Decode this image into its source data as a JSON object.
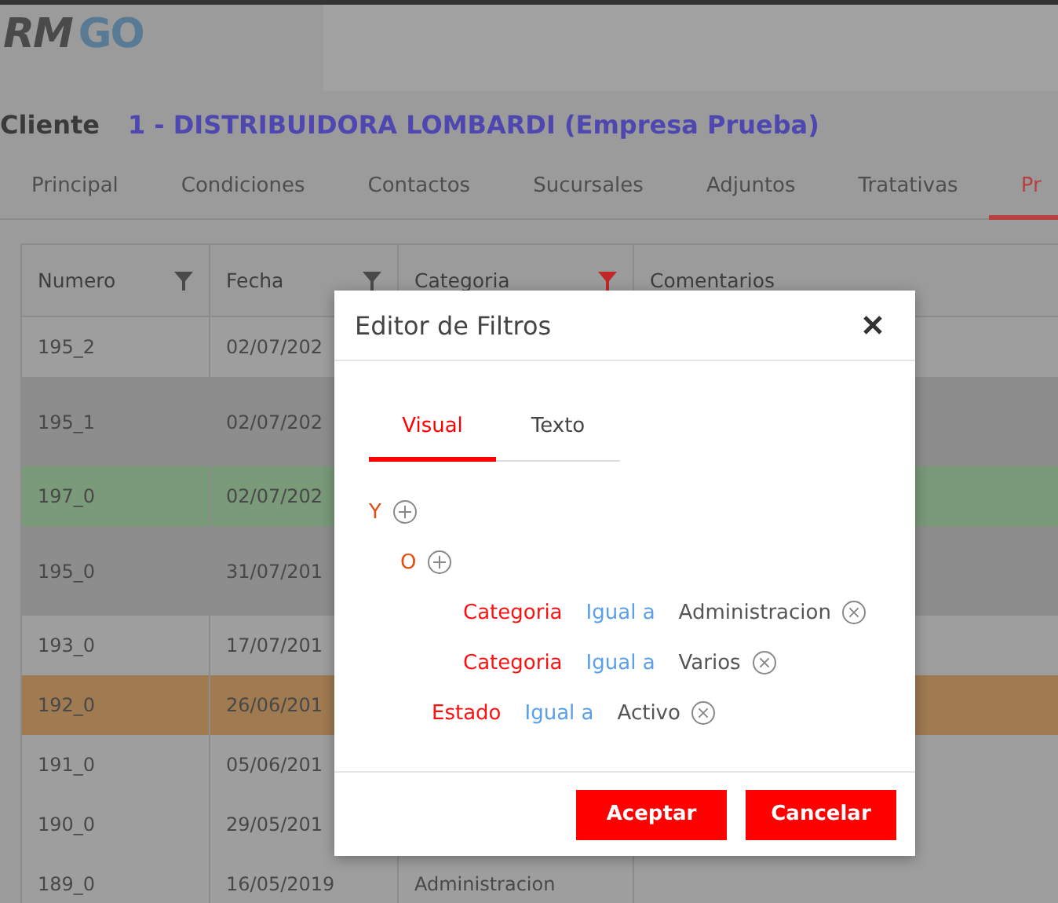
{
  "logo": {
    "part_1": "RM",
    "part_2": "GO"
  },
  "client": {
    "label": "Cliente",
    "name": "1 - DISTRIBUIDORA LOMBARDI (Empresa Prueba)"
  },
  "tabs": [
    {
      "label": "Principal",
      "selected": false
    },
    {
      "label": "Condiciones",
      "selected": false
    },
    {
      "label": "Contactos",
      "selected": false
    },
    {
      "label": "Sucursales",
      "selected": false
    },
    {
      "label": "Adjuntos",
      "selected": false
    },
    {
      "label": "Tratativas",
      "selected": false
    },
    {
      "label": "Pr",
      "selected": true
    }
  ],
  "table": {
    "columns": [
      {
        "label": "Numero",
        "kind": "filterable",
        "filter_active": false
      },
      {
        "label": "Fecha",
        "kind": "filterable",
        "filter_active": false
      },
      {
        "label": "Categoria",
        "kind": "filterable",
        "filter_active": true
      },
      {
        "label": "Comentarios",
        "kind": "plain"
      }
    ],
    "rows": [
      {
        "numero": "195_2",
        "fecha": "02/07/202",
        "color": "#9e9e9e",
        "tall": false
      },
      {
        "numero": "195_1",
        "fecha": "02/07/202",
        "color": "#8d8d8d",
        "tall": true
      },
      {
        "numero": "197_0",
        "fecha": "02/07/202",
        "color": "#7a9a7a",
        "tall": false
      },
      {
        "numero": "195_0",
        "fecha": "31/07/201",
        "color": "#8d8d8d",
        "tall": true
      },
      {
        "numero": "193_0",
        "fecha": "17/07/201",
        "color": "#9e9e9e",
        "tall": false
      },
      {
        "numero": "192_0",
        "fecha": "26/06/201",
        "color": "#a07a50",
        "tall": false
      },
      {
        "numero": "191_0",
        "fecha": "05/06/201",
        "color": "#9e9e9e",
        "tall": false
      },
      {
        "numero": "190_0",
        "fecha": "29/05/201",
        "color": "#9e9e9e",
        "tall": false
      },
      {
        "numero": "189_0",
        "fecha": "16/05/2019",
        "categoria": "Administracion",
        "color": "#9e9e9e",
        "tall": false
      }
    ]
  },
  "dialog": {
    "title": "Editor de Filtros",
    "tabs": [
      {
        "label": "Visual",
        "selected": true
      },
      {
        "label": "Texto",
        "selected": false
      }
    ],
    "tree": [
      {
        "kind": "group",
        "operator": "Y",
        "children": [
          {
            "kind": "group",
            "operator": "O",
            "children": [
              {
                "kind": "condition",
                "field": "Categoria",
                "comparison": "Igual a",
                "value": "Administracion"
              },
              {
                "kind": "condition",
                "field": "Categoria",
                "comparison": "Igual a",
                "value": "Varios"
              }
            ]
          },
          {
            "kind": "condition",
            "field": "Estado",
            "comparison": "Igual a",
            "value": "Activo"
          }
        ]
      }
    ],
    "buttons": [
      {
        "label": "Aceptar"
      },
      {
        "label": "Cancelar"
      }
    ]
  }
}
